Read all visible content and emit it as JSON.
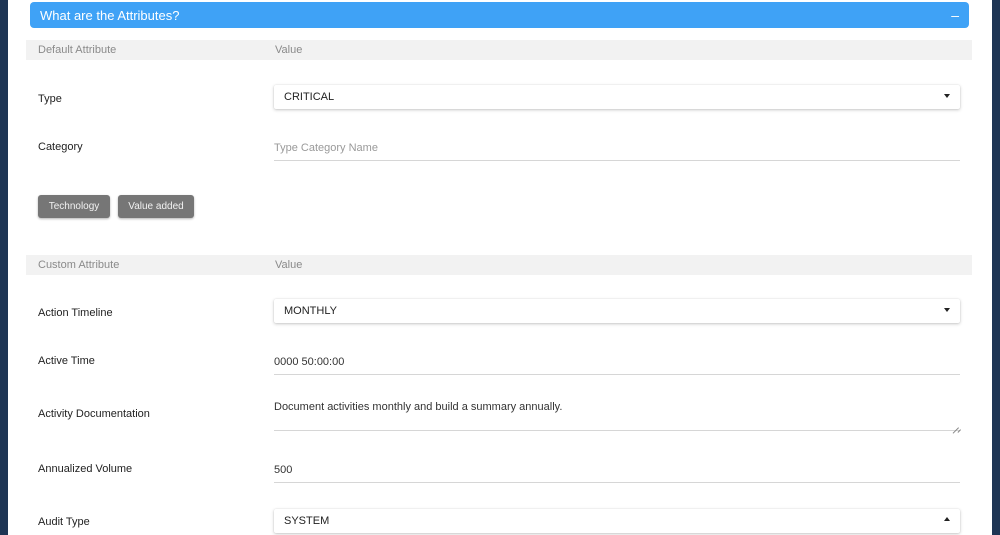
{
  "accordion": {
    "title": "What are the Attributes?",
    "collapse_symbol": "–"
  },
  "default_section": {
    "col_attribute": "Default Attribute",
    "col_value": "Value"
  },
  "type_row": {
    "label": "Type",
    "value": "CRITICAL"
  },
  "category_row": {
    "label": "Category",
    "placeholder": "Type Category Name"
  },
  "tags": [
    "Technology",
    "Value added"
  ],
  "custom_section": {
    "col_attribute": "Custom Attribute",
    "col_value": "Value"
  },
  "action_timeline": {
    "label": "Action Timeline",
    "value": "MONTHLY"
  },
  "active_time": {
    "label": "Active Time",
    "value": "0000 50:00:00"
  },
  "activity_documentation": {
    "label": "Activity Documentation",
    "value": "Document activities monthly and build a summary annually."
  },
  "annualized_volume": {
    "label": "Annualized Volume",
    "value": "500"
  },
  "audit_type": {
    "label": "Audit Type",
    "value": "SYSTEM"
  }
}
